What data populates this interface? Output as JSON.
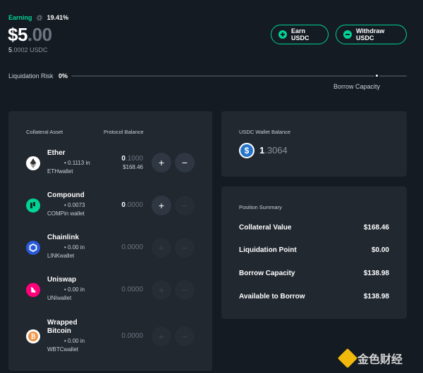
{
  "header": {
    "earning_label": "Earning",
    "earning_at": "@",
    "earning_rate": "19.41%",
    "balance_main": "$5",
    "balance_dim": ".00",
    "sub_balance_main": "5",
    "sub_balance_rest": ".0002 USDC",
    "earn_button": "Earn USDC",
    "withdraw_button": "Withdraw USDC"
  },
  "risk": {
    "label": "Liquidation Risk",
    "percent": "0%",
    "borrow_capacity_label": "Borrow Capacity",
    "level": 0
  },
  "collateral": {
    "col_asset": "Collateral Asset",
    "col_balance": "Protocol Balance",
    "assets": [
      {
        "name": "Ether",
        "wallet_line1": "• 0.1113 in",
        "wallet_line2": "ETHwallet",
        "balance_bright": "0",
        "balance_dim": ".1000",
        "usd": "$168.46",
        "icon": "ether-icon",
        "add_enabled": true,
        "remove_enabled": true
      },
      {
        "name": "Compound",
        "wallet_line1": "• 0.0073",
        "wallet_line2": "COMPin wallet",
        "balance_bright": "0",
        "balance_dim": ".0000",
        "usd": "",
        "icon": "compound-icon",
        "add_enabled": true,
        "remove_enabled": false
      },
      {
        "name": "Chainlink",
        "wallet_line1": "• 0.00 in",
        "wallet_line2": "LINKwallet",
        "balance_bright": "",
        "balance_dim": "0.0000",
        "usd": "",
        "icon": "chainlink-icon",
        "add_enabled": false,
        "remove_enabled": false
      },
      {
        "name": "Uniswap",
        "wallet_line1": "• 0.00 in",
        "wallet_line2": "UNIwallet",
        "balance_bright": "",
        "balance_dim": "0.0000",
        "usd": "",
        "icon": "uniswap-icon",
        "add_enabled": false,
        "remove_enabled": false
      },
      {
        "name": "Wrapped",
        "name2": "Bitcoin",
        "wallet_line1": "• 0.00 in",
        "wallet_line2": "WBTCwallet",
        "balance_bright": "",
        "balance_dim": "0.0000",
        "usd": "",
        "icon": "bitcoin-icon",
        "add_enabled": false,
        "remove_enabled": false
      }
    ]
  },
  "wallet": {
    "label": "USDC Wallet Balance",
    "value_bright": "1",
    "value_dim": ".3064"
  },
  "summary": {
    "title": "Position Summary",
    "rows": [
      {
        "label": "Collateral Value",
        "value": "$168.46"
      },
      {
        "label": "Liquidation Point",
        "value": "$0.00"
      },
      {
        "label": "Borrow Capacity",
        "value": "$138.98"
      },
      {
        "label": "Available to Borrow",
        "value": "$138.98"
      }
    ]
  },
  "watermark": {
    "text": "金色财经"
  },
  "colors": {
    "accent": "#00d395",
    "background": "#141b22",
    "panel": "#212830"
  }
}
